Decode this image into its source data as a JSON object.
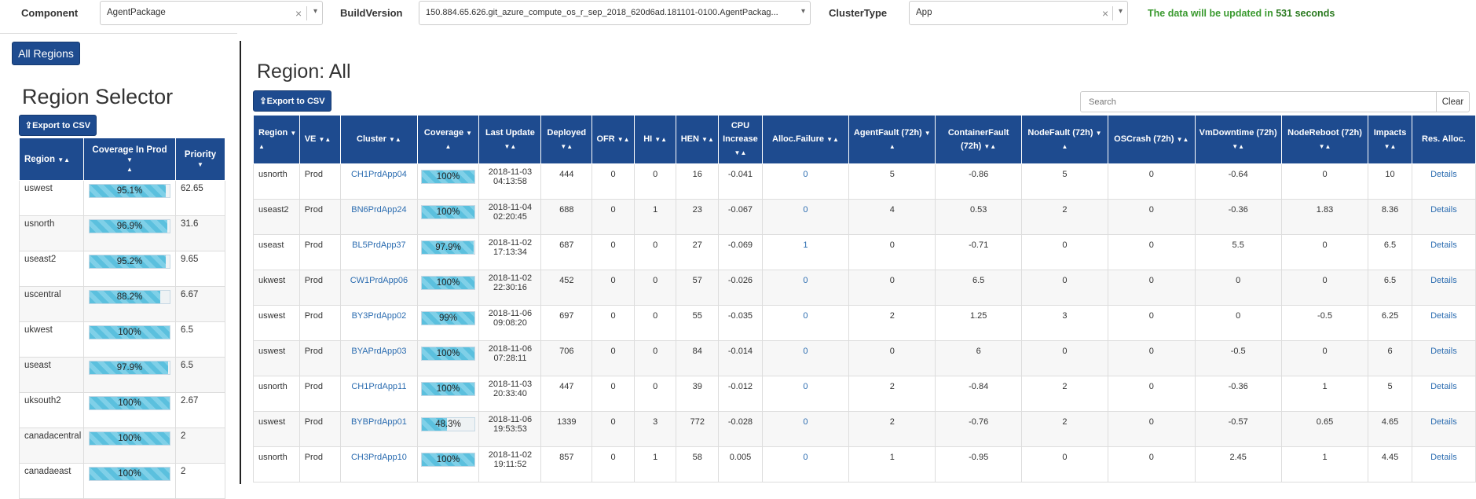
{
  "filters": {
    "component_label": "Component",
    "component_value": "AgentPackage",
    "build_label": "BuildVersion",
    "build_value": "150.884.65.626.git_azure_compute_os_r_sep_2018_620d6ad.181101-0100.AgentPackag...",
    "cluster_label": "ClusterType",
    "cluster_value": "App",
    "clear_glyph": "×",
    "caret_glyph": "▾"
  },
  "update_note": {
    "prefix": "The data will be updated in",
    "seconds": "531 seconds"
  },
  "left": {
    "all_regions_label": "All Regions",
    "title": "Region Selector",
    "export_label": "Export to CSV",
    "columns": [
      "Region",
      "Coverage In Prod",
      "Priority"
    ],
    "rows": [
      {
        "region": "uswest",
        "coverage": 95.1,
        "coverage_label": "95.1%",
        "priority": "62.65"
      },
      {
        "region": "usnorth",
        "coverage": 96.9,
        "coverage_label": "96.9%",
        "priority": "31.6"
      },
      {
        "region": "useast2",
        "coverage": 95.2,
        "coverage_label": "95.2%",
        "priority": "9.65"
      },
      {
        "region": "uscentral",
        "coverage": 88.2,
        "coverage_label": "88.2%",
        "priority": "6.67"
      },
      {
        "region": "ukwest",
        "coverage": 100,
        "coverage_label": "100%",
        "priority": "6.5"
      },
      {
        "region": "useast",
        "coverage": 97.9,
        "coverage_label": "97.9%",
        "priority": "6.5"
      },
      {
        "region": "uksouth2",
        "coverage": 100,
        "coverage_label": "100%",
        "priority": "2.67"
      },
      {
        "region": "canadacentral",
        "coverage": 100,
        "coverage_label": "100%",
        "priority": "2"
      },
      {
        "region": "canadaeast",
        "coverage": 100,
        "coverage_label": "100%",
        "priority": "2"
      }
    ]
  },
  "main": {
    "title": "Region: All",
    "export_label": "Export to CSV",
    "search_placeholder": "Search",
    "clear_label": "Clear",
    "columns": [
      "Region",
      "VE",
      "Cluster",
      "Coverage",
      "Last Update",
      "Deployed",
      "OFR",
      "HI",
      "HEN",
      "CPU Increase",
      "Alloc.Failure",
      "AgentFault (72h)",
      "ContainerFault (72h)",
      "NodeFault (72h)",
      "OSCrash (72h)",
      "VmDowntime (72h)",
      "NodeReboot (72h)",
      "Impacts",
      "Res. Alloc."
    ],
    "rows": [
      {
        "region": "usnorth",
        "ve": "Prod",
        "cluster": "CH1PrdApp04",
        "coverage": 100,
        "coverage_label": "100%",
        "date": "2018-11-03",
        "time": "04:13:58",
        "deployed": "444",
        "ofr": "0",
        "hi": "0",
        "hen": "16",
        "cpu": "-0.041",
        "alloc": "0",
        "agent": "5",
        "container": "-0.86",
        "node": "5",
        "oscrash": "0",
        "vmdown": "-0.64",
        "reboot": "0",
        "impacts": "10",
        "details": "Details"
      },
      {
        "region": "useast2",
        "ve": "Prod",
        "cluster": "BN6PrdApp24",
        "coverage": 100,
        "coverage_label": "100%",
        "date": "2018-11-04",
        "time": "02:20:45",
        "deployed": "688",
        "ofr": "0",
        "hi": "1",
        "hen": "23",
        "cpu": "-0.067",
        "alloc": "0",
        "agent": "4",
        "container": "0.53",
        "node": "2",
        "oscrash": "0",
        "vmdown": "-0.36",
        "reboot": "1.83",
        "impacts": "8.36",
        "details": "Details"
      },
      {
        "region": "useast",
        "ve": "Prod",
        "cluster": "BL5PrdApp37",
        "coverage": 97.9,
        "coverage_label": "97.9%",
        "date": "2018-11-02",
        "time": "17:13:34",
        "deployed": "687",
        "ofr": "0",
        "hi": "0",
        "hen": "27",
        "cpu": "-0.069",
        "alloc": "1",
        "agent": "0",
        "container": "-0.71",
        "node": "0",
        "oscrash": "0",
        "vmdown": "5.5",
        "reboot": "0",
        "impacts": "6.5",
        "details": "Details"
      },
      {
        "region": "ukwest",
        "ve": "Prod",
        "cluster": "CW1PrdApp06",
        "coverage": 100,
        "coverage_label": "100%",
        "date": "2018-11-02",
        "time": "22:30:16",
        "deployed": "452",
        "ofr": "0",
        "hi": "0",
        "hen": "57",
        "cpu": "-0.026",
        "alloc": "0",
        "agent": "0",
        "container": "6.5",
        "node": "0",
        "oscrash": "0",
        "vmdown": "0",
        "reboot": "0",
        "impacts": "6.5",
        "details": "Details"
      },
      {
        "region": "uswest",
        "ve": "Prod",
        "cluster": "BY3PrdApp02",
        "coverage": 99,
        "coverage_label": "99%",
        "date": "2018-11-06",
        "time": "09:08:20",
        "deployed": "697",
        "ofr": "0",
        "hi": "0",
        "hen": "55",
        "cpu": "-0.035",
        "alloc": "0",
        "agent": "2",
        "container": "1.25",
        "node": "3",
        "oscrash": "0",
        "vmdown": "0",
        "reboot": "-0.5",
        "impacts": "6.25",
        "details": "Details"
      },
      {
        "region": "uswest",
        "ve": "Prod",
        "cluster": "BYAPrdApp03",
        "coverage": 100,
        "coverage_label": "100%",
        "date": "2018-11-06",
        "time": "07:28:11",
        "deployed": "706",
        "ofr": "0",
        "hi": "0",
        "hen": "84",
        "cpu": "-0.014",
        "alloc": "0",
        "agent": "0",
        "container": "6",
        "node": "0",
        "oscrash": "0",
        "vmdown": "-0.5",
        "reboot": "0",
        "impacts": "6",
        "details": "Details"
      },
      {
        "region": "usnorth",
        "ve": "Prod",
        "cluster": "CH1PrdApp11",
        "coverage": 100,
        "coverage_label": "100%",
        "date": "2018-11-03",
        "time": "20:33:40",
        "deployed": "447",
        "ofr": "0",
        "hi": "0",
        "hen": "39",
        "cpu": "-0.012",
        "alloc": "0",
        "agent": "2",
        "container": "-0.84",
        "node": "2",
        "oscrash": "0",
        "vmdown": "-0.36",
        "reboot": "1",
        "impacts": "5",
        "details": "Details"
      },
      {
        "region": "uswest",
        "ve": "Prod",
        "cluster": "BYBPrdApp01",
        "coverage": 48.3,
        "coverage_label": "48.3%",
        "date": "2018-11-06",
        "time": "19:53:53",
        "deployed": "1339",
        "ofr": "0",
        "hi": "3",
        "hen": "772",
        "cpu": "-0.028",
        "alloc": "0",
        "agent": "2",
        "container": "-0.76",
        "node": "2",
        "oscrash": "0",
        "vmdown": "-0.57",
        "reboot": "0.65",
        "impacts": "4.65",
        "details": "Details"
      },
      {
        "region": "usnorth",
        "ve": "Prod",
        "cluster": "CH3PrdApp10",
        "coverage": 100,
        "coverage_label": "100%",
        "date": "2018-11-02",
        "time": "19:11:52",
        "deployed": "857",
        "ofr": "0",
        "hi": "1",
        "hen": "58",
        "cpu": "0.005",
        "alloc": "0",
        "agent": "1",
        "container": "-0.95",
        "node": "0",
        "oscrash": "0",
        "vmdown": "2.45",
        "reboot": "1",
        "impacts": "4.45",
        "details": "Details"
      }
    ]
  },
  "colors": {
    "header_bg": "#1e4b8f",
    "bar_fill": "#5bc0de",
    "link": "#2b6cb0",
    "update_note": "#3a9a2f"
  },
  "icons": {
    "sort": "sort-both-icon",
    "sort_down": "sort-desc-icon",
    "export": "export-icon"
  }
}
